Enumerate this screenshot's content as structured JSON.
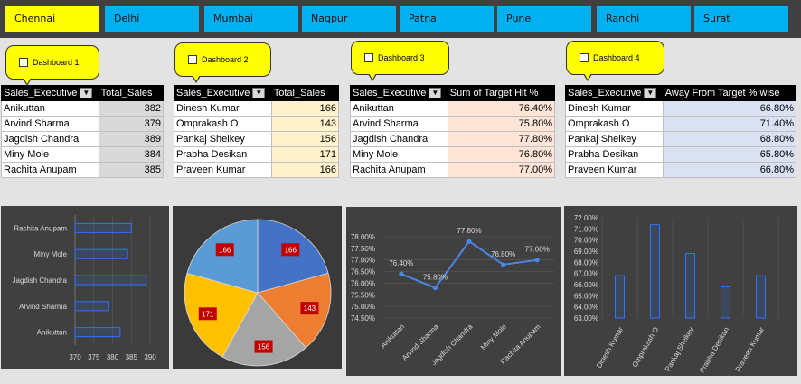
{
  "tabs": [
    "Chennai",
    "Delhi",
    "Mumbai",
    "Nagpur",
    "Patna",
    "Pune",
    "Ranchi",
    "Surat"
  ],
  "active_tab": "Chennai",
  "dashboards": [
    "Dashboard 1",
    "Dashboard 2",
    "Dashboard 3",
    "Dashboard 4"
  ],
  "tables": [
    {
      "col1": "Sales_Executive",
      "col2": "Total_Sales",
      "rows": [
        [
          "Anikuttan",
          "382"
        ],
        [
          "Arvind Sharma",
          "379"
        ],
        [
          "Jagdish Chandra",
          "389"
        ],
        [
          "Miny Mole",
          "384"
        ],
        [
          "Rachita Anupam",
          "385"
        ]
      ],
      "fill": "#d9d9d9"
    },
    {
      "col1": "Sales_Executive",
      "col2": "Total_Sales",
      "rows": [
        [
          "Dinesh Kumar",
          "166"
        ],
        [
          "Omprakash O",
          "143"
        ],
        [
          "Pankaj Shelkey",
          "156"
        ],
        [
          "Prabha Desikan",
          "171"
        ],
        [
          "Praveen Kumar",
          "166"
        ]
      ],
      "fill": "#fff2cc"
    },
    {
      "col1": "Sales_Executive",
      "col2": "Sum of Target Hit %",
      "rows": [
        [
          "Anikuttan",
          "76.40%"
        ],
        [
          "Arvind Sharma",
          "75.80%"
        ],
        [
          "Jagdish Chandra",
          "77.80%"
        ],
        [
          "Miny Mole",
          "76.80%"
        ],
        [
          "Rachita Anupam",
          "77.00%"
        ]
      ],
      "fill": "#fce4d6"
    },
    {
      "col1": "Sales_Executive",
      "col2": "Away From Target % wise",
      "rows": [
        [
          "Dinesh Kumar",
          "66.80%"
        ],
        [
          "Omprakash O",
          "71.40%"
        ],
        [
          "Pankaj Shelkey",
          "68.80%"
        ],
        [
          "Prabha Desikan",
          "65.80%"
        ],
        [
          "Praveen Kumar",
          "66.80%"
        ]
      ],
      "fill": "#d9e1f2"
    }
  ],
  "chart_data": [
    {
      "type": "bar",
      "orientation": "horizontal",
      "categories": [
        "Anikuttan",
        "Arvind Sharma",
        "Jagdish Chandra",
        "Miny Mole",
        "Rachita Anupam"
      ],
      "values": [
        382,
        379,
        389,
        384,
        385
      ],
      "xlim": [
        370,
        390
      ],
      "xticks": [
        "370",
        "375",
        "380",
        "385",
        "390"
      ],
      "color": "#2f75ff"
    },
    {
      "type": "pie",
      "categories": [
        "Dinesh Kumar",
        "Omprakash O",
        "Pankaj Shelkey",
        "Prabha Desikan",
        "Praveen Kumar"
      ],
      "values": [
        166,
        143,
        156,
        171,
        166
      ],
      "colors": [
        "#4472c4",
        "#ed7d31",
        "#a5a5a5",
        "#ffc000",
        "#5b9bd5"
      ]
    },
    {
      "type": "line",
      "categories": [
        "Anikuttan",
        "Arvind Sharma",
        "Jagdish Chandra",
        "Miny Mole",
        "Rachita Anupam"
      ],
      "values": [
        76.4,
        75.8,
        77.8,
        76.8,
        77.0
      ],
      "labels": [
        "76.40%",
        "75.80%",
        "77.80%",
        "76.80%",
        "77.00%"
      ],
      "ylim": [
        74.5,
        78.0
      ],
      "yticks": [
        "74.50%",
        "75.00%",
        "75.50%",
        "76.00%",
        "76.50%",
        "77.00%",
        "77.50%",
        "78.00%"
      ],
      "color": "#4a86e8"
    },
    {
      "type": "bar",
      "categories": [
        "Dinesh Kumar",
        "Omprakash O",
        "Pankaj Shelkey",
        "Prabha Desikan",
        "Praveen Kumar"
      ],
      "values": [
        66.8,
        71.4,
        68.8,
        65.8,
        66.8
      ],
      "ylim": [
        63.0,
        72.0
      ],
      "yticks": [
        "63.00%",
        "64.00%",
        "65.00%",
        "66.00%",
        "67.00%",
        "68.00%",
        "69.00%",
        "70.00%",
        "71.00%",
        "72.00%"
      ],
      "color": "#2f75ff"
    }
  ]
}
